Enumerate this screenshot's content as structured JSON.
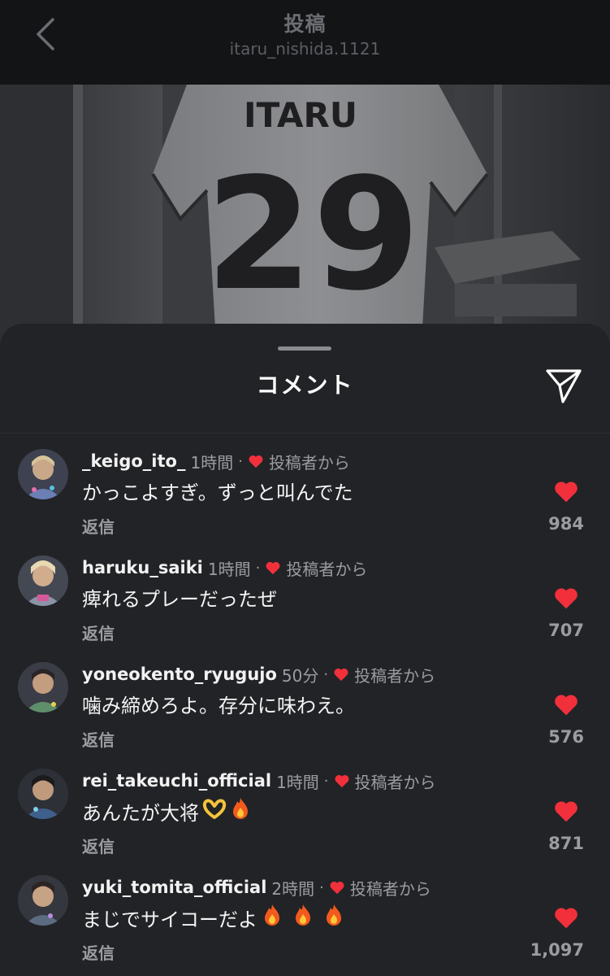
{
  "header": {
    "title": "投稿",
    "subtitle": "itaru_nishida.1121"
  },
  "post": {
    "jersey_name": "ITARU",
    "jersey_number": "29"
  },
  "sheet": {
    "title": "コメント"
  },
  "comments": [
    {
      "username": "_keigo_ito_",
      "time": "1時間",
      "separator": "·",
      "creator_label": "投稿者から",
      "text": "かっこよすぎ。ずっと叫んでた",
      "emojis": [],
      "reply_label": "返信",
      "likes": "984"
    },
    {
      "username": "haruku_saiki",
      "time": "1時間",
      "separator": "·",
      "creator_label": "投稿者から",
      "text": "痺れるプレーだったぜ",
      "emojis": [],
      "reply_label": "返信",
      "likes": "707"
    },
    {
      "username": "yoneokento_ryugujo",
      "time": "50分",
      "separator": "·",
      "creator_label": "投稿者から",
      "text": "噛み締めろよ。存分に味わえ。",
      "emojis": [],
      "reply_label": "返信",
      "likes": "576"
    },
    {
      "username": "rei_takeuchi_official",
      "time": "1時間",
      "separator": "·",
      "creator_label": "投稿者から",
      "text": "あんたが大将",
      "emojis": [
        "heart-hands-emoji",
        "fire-emoji"
      ],
      "reply_label": "返信",
      "likes": "871"
    },
    {
      "username": "yuki_tomita_official",
      "time": "2時間",
      "separator": "·",
      "creator_label": "投稿者から",
      "text": "まじでサイコーだよ",
      "emojis": [
        "fire-emoji",
        "fire-emoji",
        "fire-emoji"
      ],
      "reply_label": "返信",
      "likes": "1,097"
    }
  ],
  "colors": {
    "like_red": "#f2303c",
    "sheet_bg": "#222326",
    "muted_text": "#9a9ca1"
  },
  "icons": {
    "back": "chevron-left-icon",
    "share": "paper-plane-icon",
    "like": "heart-filled-icon"
  }
}
